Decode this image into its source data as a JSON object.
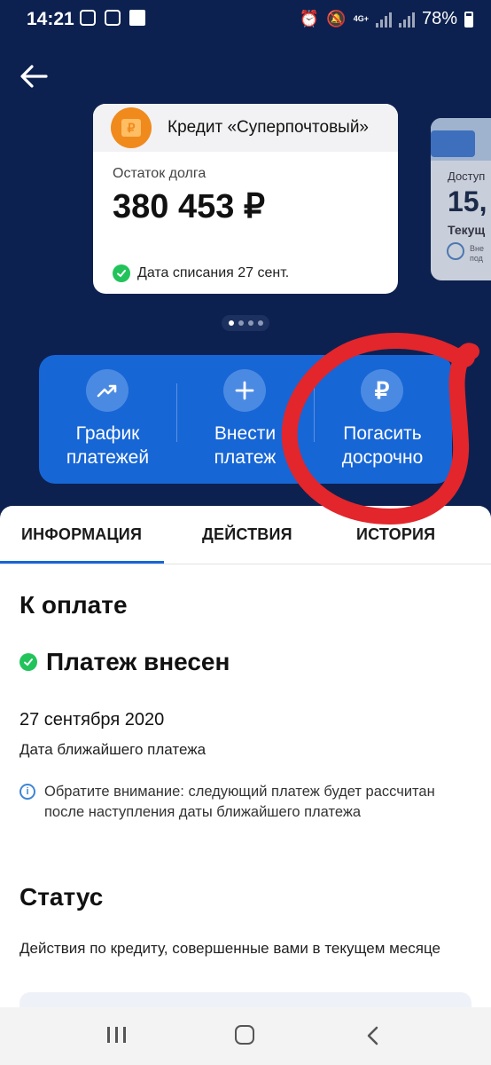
{
  "status_bar": {
    "time": "14:21",
    "network": "4G+",
    "battery": "78%",
    "icons": [
      "instagram-icon",
      "app-icon",
      "app-icon",
      "alarm-icon",
      "mute-icon",
      "signal-icon",
      "battery-icon"
    ]
  },
  "card": {
    "title": "Кредит «Суперпочтовый»",
    "debt_label": "Остаток долга",
    "amount": "380 453 ₽",
    "coin_symbol": "₽",
    "date_text": "Дата списания 27 сент."
  },
  "peek_card": {
    "line1": "Доступ",
    "line2": "15,",
    "line3": "Текущ",
    "line4a": "Вне",
    "line4b": "под"
  },
  "carousel": {
    "pages": 4,
    "active": 1
  },
  "actions": [
    {
      "label_1": "График",
      "label_2": "платежей",
      "icon": "trend-up-icon"
    },
    {
      "label_1": "Внести",
      "label_2": "платеж",
      "icon": "plus-icon"
    },
    {
      "label_1": "Погасить",
      "label_2": "досрочно",
      "icon": "ruble-icon",
      "icon_text": "₽"
    }
  ],
  "tabs": [
    {
      "label": "ИНФОРМАЦИЯ",
      "active": true
    },
    {
      "label": "ДЕЙСТВИЯ",
      "active": false
    },
    {
      "label": "ИСТОРИЯ",
      "active": false
    }
  ],
  "info": {
    "to_pay_heading": "К оплате",
    "payment_status": "Платеж внесен",
    "next_date": "27 сентября 2020",
    "next_date_caption": "Дата ближайшего платежа",
    "note": "Обратите внимание: следующий платеж будет рассчитан после наступления даты ближайшего платежа",
    "status_heading": "Статус",
    "status_desc": "Действия по кредиту, совершенные вами в текущем месяце"
  },
  "colors": {
    "background": "#0d2150",
    "action_panel": "#1766d6",
    "accent_orange": "#f08a1c",
    "success_green": "#22c35b",
    "highlight_red": "#e2262b"
  }
}
